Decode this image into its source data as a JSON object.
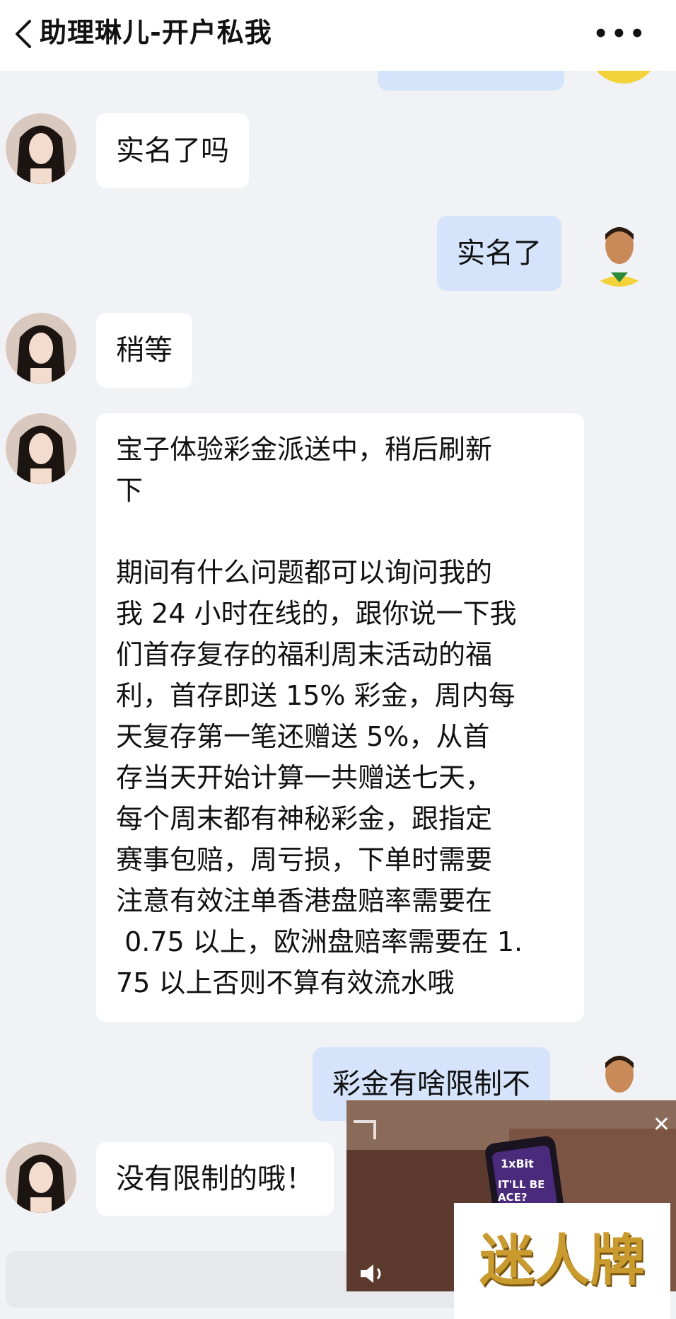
{
  "header": {
    "title": "助理琳儿-开户私我",
    "more_label": "•••"
  },
  "messages": [
    {
      "side": "in",
      "text": "实名了吗"
    },
    {
      "side": "out",
      "text": "实名了"
    },
    {
      "side": "in",
      "text": "稍等"
    },
    {
      "side": "in",
      "text": "宝子体验彩金派送中，稍后刷新\n下\n\n期间有什么问题都可以询问我的\n我 24 小时在线的，跟你说一下我\n们首存复存的福利周末活动的福\n利，首存即送 15% 彩金，周内每\n天复存第一笔还赠送 5%，从首\n存当天开始计算一共赠送七天，\n每个周末都有神秘彩金，跟指定\n赛事包赔，周亏损，下单时需要\n注意有效注单香港盘赔率需要在\n 0.75 以上，欧洲盘赔率需要在 1.\n75 以上否则不算有效流水哦"
    },
    {
      "side": "out",
      "text": "彩金有啥限制不"
    },
    {
      "side": "in",
      "text": "没有限制的哦！"
    }
  ],
  "ad": {
    "video_overlay_text": "IT'LL BE ACE?",
    "brand_badge": "1xBit",
    "logo_text": "迷人牌",
    "close_label": "✕"
  },
  "colors": {
    "outgoing_bubble": "#d5e4fb",
    "incoming_bubble": "#ffffff",
    "background": "#f1f2f6"
  }
}
